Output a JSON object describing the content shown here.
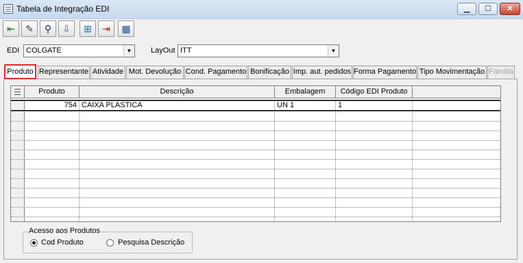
{
  "window": {
    "title": "Tabela de Integração EDI",
    "controls": {
      "minimize": "▁",
      "maximize": "☐",
      "close": "✕"
    }
  },
  "toolbar": {
    "buttons": [
      {
        "name": "exit-icon",
        "glyph": "⇤"
      },
      {
        "name": "edit-icon",
        "glyph": "✎"
      },
      {
        "name": "binoculars-icon",
        "glyph": "⚲"
      },
      {
        "name": "import-icon",
        "glyph": "⇩"
      },
      {
        "name": "add-row-icon",
        "glyph": "⊞"
      },
      {
        "name": "delete-row-icon",
        "glyph": "⇥"
      },
      {
        "name": "new-table-icon",
        "glyph": "▦"
      }
    ]
  },
  "selectors": {
    "edi_label": "EDI",
    "edi_value": "COLGATE",
    "layout_label": "LayOut",
    "layout_value": "ITT"
  },
  "tabs": [
    {
      "label": "Produto",
      "active": true,
      "disabled": false
    },
    {
      "label": "Representante",
      "active": false,
      "disabled": false
    },
    {
      "label": "Atividade",
      "active": false,
      "disabled": false
    },
    {
      "label": "Mot. Devolução",
      "active": false,
      "disabled": false
    },
    {
      "label": "Cond. Pagamento",
      "active": false,
      "disabled": false
    },
    {
      "label": "Bonificação",
      "active": false,
      "disabled": false
    },
    {
      "label": "Imp. aut. pedidos",
      "active": false,
      "disabled": false
    },
    {
      "label": "Forma Pagamento",
      "active": false,
      "disabled": false
    },
    {
      "label": "Tipo Movimentação",
      "active": false,
      "disabled": false
    },
    {
      "label": "Família",
      "active": false,
      "disabled": true
    }
  ],
  "grid": {
    "columns": [
      "Produto",
      "Descrição",
      "Embalagem",
      "Código EDI Produto"
    ],
    "rows": [
      [
        "754",
        "CAIXA PLASTICA",
        "UN  1",
        "1"
      ]
    ]
  },
  "access_group": {
    "label": "Acesso aos Produtos",
    "options": [
      {
        "label": "Cod Produto",
        "selected": true
      },
      {
        "label": "Pesquisa Descrição",
        "selected": false
      }
    ]
  }
}
